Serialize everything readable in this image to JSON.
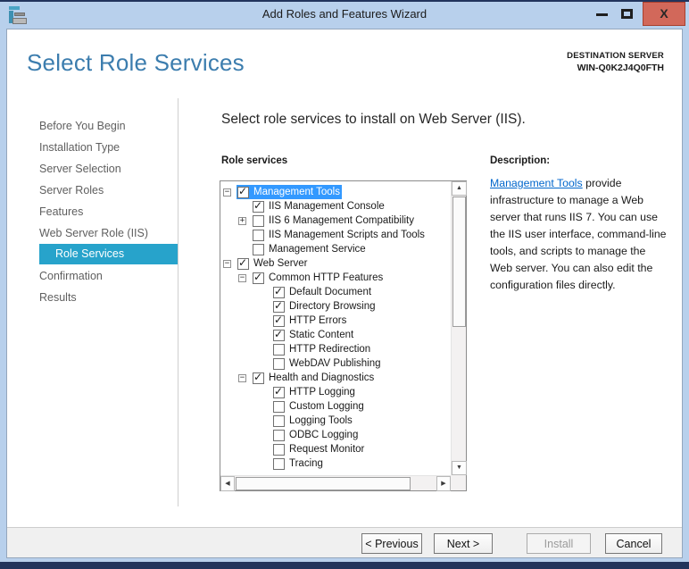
{
  "window": {
    "title": "Add Roles and Features Wizard"
  },
  "header": {
    "title": "Select Role Services",
    "destination_label": "DESTINATION SERVER",
    "destination_server": "WIN-Q0K2J4Q0FTH"
  },
  "sidebar": {
    "items": [
      {
        "label": "Before You Begin",
        "active": false,
        "indent": false
      },
      {
        "label": "Installation Type",
        "active": false,
        "indent": false
      },
      {
        "label": "Server Selection",
        "active": false,
        "indent": false
      },
      {
        "label": "Server Roles",
        "active": false,
        "indent": false
      },
      {
        "label": "Features",
        "active": false,
        "indent": false
      },
      {
        "label": "Web Server Role (IIS)",
        "active": false,
        "indent": false
      },
      {
        "label": "Role Services",
        "active": true,
        "indent": true
      },
      {
        "label": "Confirmation",
        "active": false,
        "indent": false
      },
      {
        "label": "Results",
        "active": false,
        "indent": false
      }
    ]
  },
  "main": {
    "subtitle": "Select role services to install on Web Server (IIS).",
    "tree_label": "Role services",
    "tree": [
      {
        "label": "Management Tools",
        "level": 0,
        "expand": "minus",
        "checked": true,
        "selected": true
      },
      {
        "label": "IIS Management Console",
        "level": 1,
        "expand": "none",
        "checked": true,
        "selected": false
      },
      {
        "label": "IIS 6 Management Compatibility",
        "level": 1,
        "expand": "plus",
        "checked": false,
        "selected": false
      },
      {
        "label": "IIS Management Scripts and Tools",
        "level": 1,
        "expand": "none",
        "checked": false,
        "selected": false
      },
      {
        "label": "Management Service",
        "level": 1,
        "expand": "none",
        "checked": false,
        "selected": false
      },
      {
        "label": "Web Server",
        "level": 0,
        "expand": "minus",
        "checked": true,
        "selected": false
      },
      {
        "label": "Common HTTP Features",
        "level": 1,
        "expand": "minus",
        "checked": true,
        "selected": false
      },
      {
        "label": "Default Document",
        "level": 2,
        "expand": "none",
        "checked": true,
        "selected": false
      },
      {
        "label": "Directory Browsing",
        "level": 2,
        "expand": "none",
        "checked": true,
        "selected": false
      },
      {
        "label": "HTTP Errors",
        "level": 2,
        "expand": "none",
        "checked": true,
        "selected": false
      },
      {
        "label": "Static Content",
        "level": 2,
        "expand": "none",
        "checked": true,
        "selected": false
      },
      {
        "label": "HTTP Redirection",
        "level": 2,
        "expand": "none",
        "checked": false,
        "selected": false
      },
      {
        "label": "WebDAV Publishing",
        "level": 2,
        "expand": "none",
        "checked": false,
        "selected": false
      },
      {
        "label": "Health and Diagnostics",
        "level": 1,
        "expand": "minus",
        "checked": true,
        "selected": false
      },
      {
        "label": "HTTP Logging",
        "level": 2,
        "expand": "none",
        "checked": true,
        "selected": false
      },
      {
        "label": "Custom Logging",
        "level": 2,
        "expand": "none",
        "checked": false,
        "selected": false
      },
      {
        "label": "Logging Tools",
        "level": 2,
        "expand": "none",
        "checked": false,
        "selected": false
      },
      {
        "label": "ODBC Logging",
        "level": 2,
        "expand": "none",
        "checked": false,
        "selected": false
      },
      {
        "label": "Request Monitor",
        "level": 2,
        "expand": "none",
        "checked": false,
        "selected": false
      },
      {
        "label": "Tracing",
        "level": 2,
        "expand": "none",
        "checked": false,
        "selected": false
      }
    ]
  },
  "description": {
    "label": "Description:",
    "link_text": "Management Tools",
    "body": " provide infrastructure to manage a Web server that runs IIS 7. You can use the IIS user interface, command-line tools, and scripts to manage the Web server. You can also edit the configuration files directly."
  },
  "footer": {
    "buttons": [
      {
        "label": "< Previous",
        "enabled": true
      },
      {
        "label": "Next >",
        "enabled": true
      },
      {
        "label": "Install",
        "enabled": false
      },
      {
        "label": "Cancel",
        "enabled": true
      }
    ]
  },
  "colors": {
    "accent_teal": "#27a3cb",
    "selection_blue": "#3399ff",
    "heading_blue": "#3c7dae",
    "link_blue": "#0066cc",
    "frame_blue": "#b8d0ec",
    "close_button_red": "#d2685a"
  }
}
